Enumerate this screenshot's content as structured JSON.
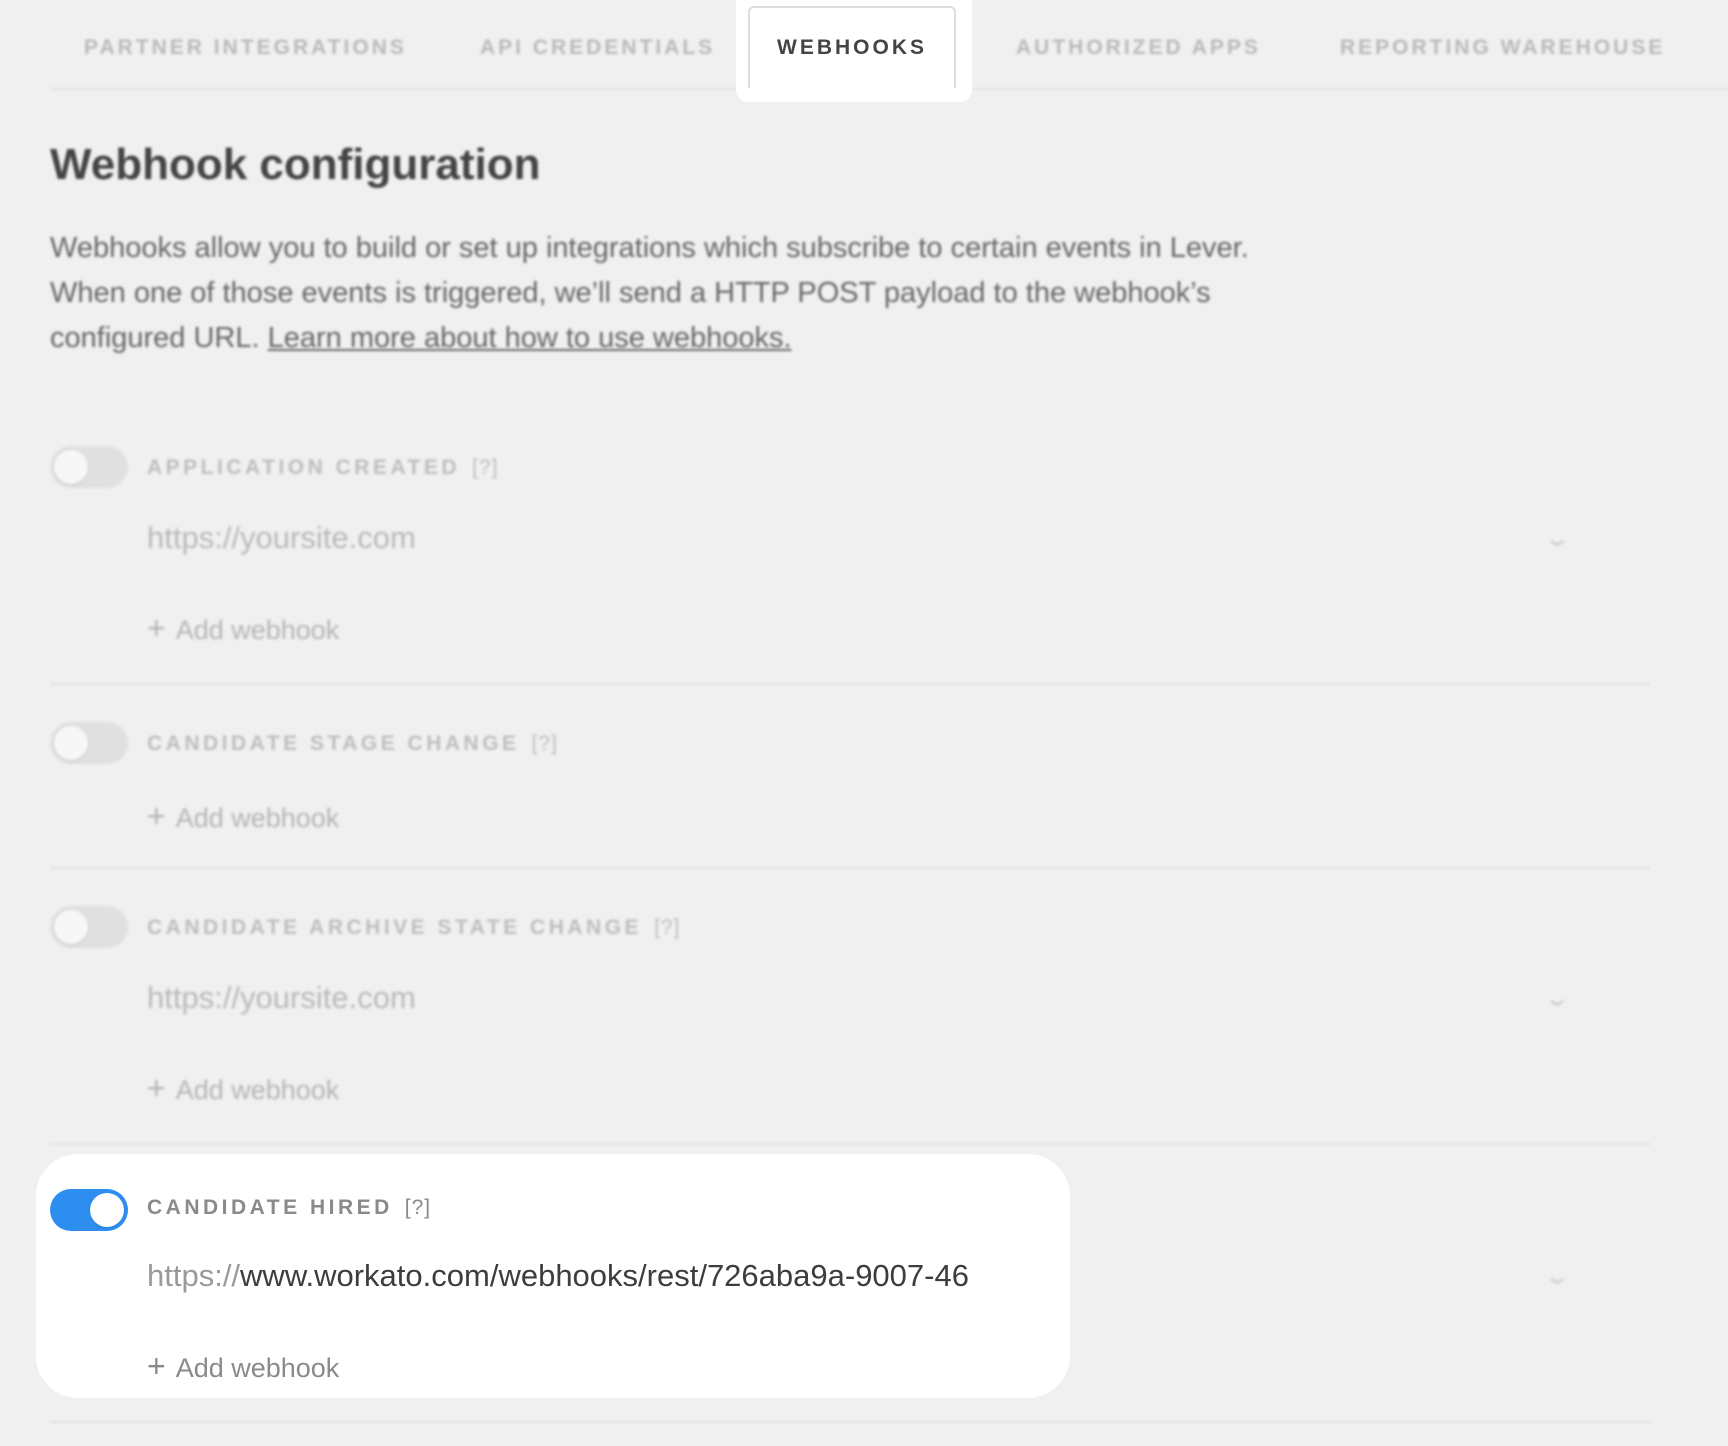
{
  "tabs": [
    {
      "label": "PARTNER INTEGRATIONS"
    },
    {
      "label": "API CREDENTIALS"
    },
    {
      "label": "WEBHOOKS",
      "active": true
    },
    {
      "label": "AUTHORIZED APPS"
    },
    {
      "label": "REPORTING WAREHOUSE"
    }
  ],
  "page": {
    "title": "Webhook configuration",
    "intro": "Webhooks allow you to build or set up integrations which subscribe to certain events in Lever. When one of those events is triggered, we’ll send a HTTP POST payload to the webhook’s configured URL.",
    "learn_more": "Learn more about how to use webhooks."
  },
  "webhooks": [
    {
      "event": "APPLICATION CREATED",
      "help": "[?]",
      "enabled": false,
      "url_prefix": "https://",
      "url": "yoursite.com",
      "add_label": "Add webhook"
    },
    {
      "event": "CANDIDATE STAGE CHANGE",
      "help": "[?]",
      "enabled": false,
      "add_label": "Add webhook"
    },
    {
      "event": "CANDIDATE ARCHIVE STATE CHANGE",
      "help": "[?]",
      "enabled": false,
      "url_prefix": "https://",
      "url": "yoursite.com",
      "add_label": "Add webhook"
    },
    {
      "event": "CANDIDATE HIRED",
      "help": "[?]",
      "enabled": true,
      "url_prefix": "https://",
      "url": "www.workato.com/webhooks/rest/726aba9a-9007-46",
      "add_label": "Add webhook"
    }
  ],
  "colors": {
    "toggle_on": "#2e8ef0",
    "background": "#f0f0f0"
  }
}
